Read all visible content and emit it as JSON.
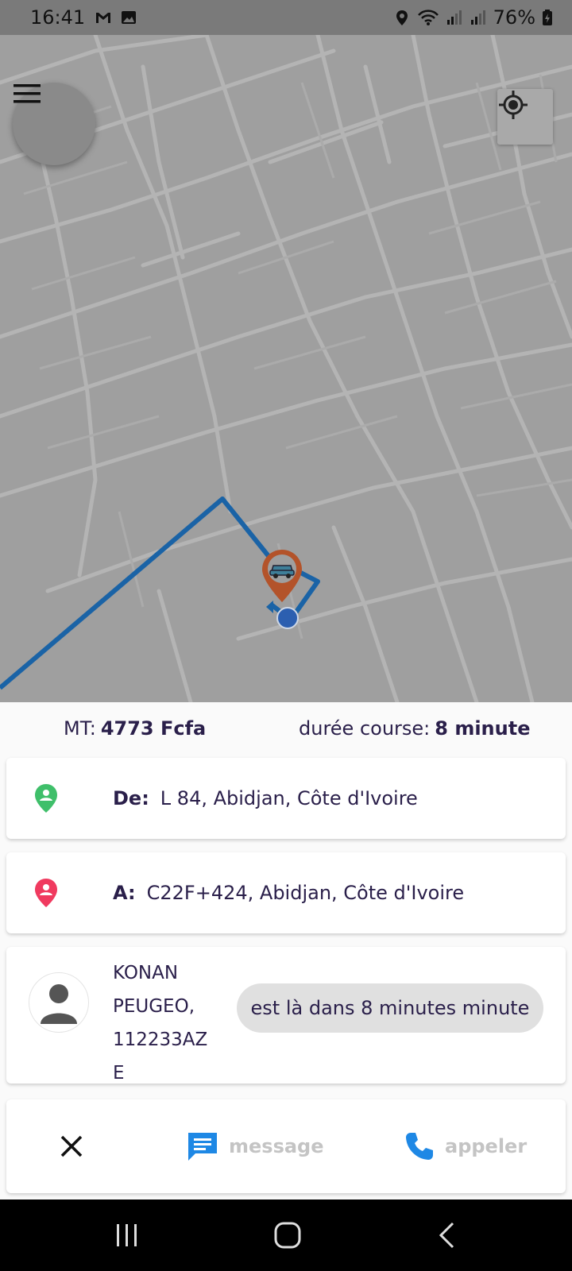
{
  "status_bar": {
    "time": "16:41",
    "battery": "76%",
    "left_icons": [
      "gmail-icon",
      "image-icon"
    ],
    "right_icons": [
      "location-icon",
      "wifi-icon",
      "signal-icon",
      "signal-icon",
      "battery-charging-icon"
    ]
  },
  "map": {
    "menu_icon": "hamburger-icon",
    "locate_icon": "my-location-icon",
    "route_color": "#1a63a6",
    "marker_color": "#b3532a",
    "marker_icon": "car-icon"
  },
  "info": {
    "amount_label": "MT:",
    "amount_value": "4773 Fcfa",
    "duration_label": "durée course:",
    "duration_value": "8 minute"
  },
  "from": {
    "label": "De:",
    "address": "L 84, Abidjan, Côte d'Ivoire",
    "icon": "pickup-pin-icon",
    "color": "#3fbf6a"
  },
  "to": {
    "label": "A:",
    "address": "C22F+424, Abidjan, Côte d'Ivoire",
    "icon": "destination-pin-icon",
    "color": "#f03a5f"
  },
  "driver": {
    "name": "KONAN",
    "vehicle": "PEUGEO,",
    "plate": "112233AZE",
    "eta": "est là dans 8 minutes minute"
  },
  "actions": {
    "cancel_icon": "close-icon",
    "message_label": "message",
    "call_label": "appeler",
    "accent": "#1e88e5"
  },
  "nav_bar": {
    "buttons": [
      "recent-apps-icon",
      "home-icon",
      "back-icon"
    ]
  }
}
